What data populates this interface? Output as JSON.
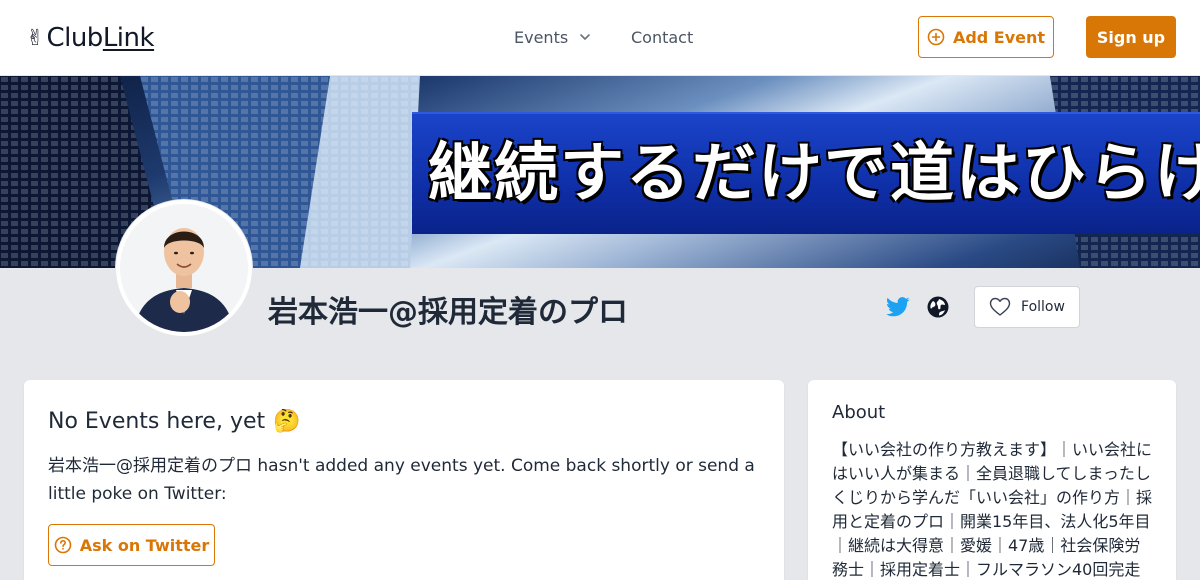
{
  "header": {
    "logo_club": "Club",
    "logo_link": "Link",
    "logo_hand": "✌",
    "nav_events": "Events",
    "nav_contact": "Contact",
    "add_event_label": "Add Event",
    "signup_label": "Sign up"
  },
  "banner": {
    "text": "継続するだけで道はひらける"
  },
  "profile": {
    "name": "岩本浩一@採用定着のプロ",
    "follow_label": "Follow"
  },
  "events_card": {
    "title": "No Events here, yet",
    "emoji": "🤔",
    "message": "岩本浩一@採用定着のプロ hasn't added any events yet. Come back shortly or send a little poke on Twitter:",
    "ask_button": "Ask on Twitter"
  },
  "about_card": {
    "title": "About",
    "text": "【いい会社の作り方教えます】｜いい会社にはいい人が集まる｜全員退職してしまったしくじりから学んだ「いい会社」の作り方｜採用と定着のプロ｜開業15年目、法人化5年目｜継続は大得意｜愛媛｜47歳｜社会保険労務士｜採用定着士｜フルマラソン40回完走"
  },
  "colors": {
    "accent": "#d97706",
    "twitter": "#1da1f2",
    "background": "#e5e7eb"
  },
  "icons": [
    "chevron-down-icon",
    "plus-circle-icon",
    "twitter-icon",
    "globe-icon",
    "heart-icon",
    "question-circle-icon"
  ]
}
